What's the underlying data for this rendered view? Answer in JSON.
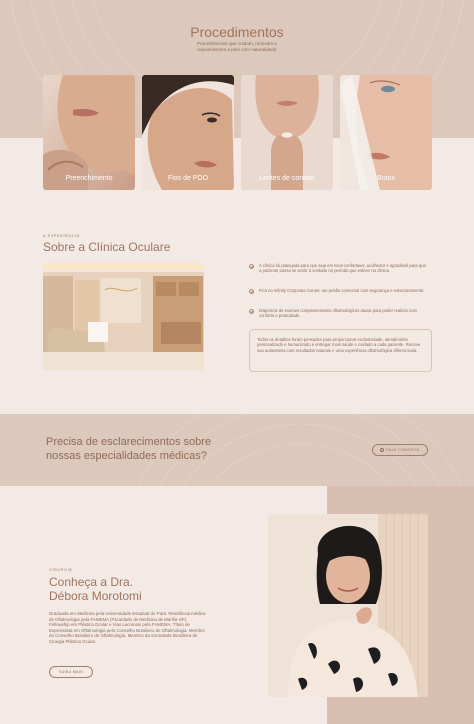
{
  "procedures": {
    "title": "Procedimentos",
    "subtitle": "Procedimentos que cuidam, renovam e rejuvenescem a pele com naturalidade",
    "cards": [
      {
        "label": "Preenchimento"
      },
      {
        "label": "Fios de PDO"
      },
      {
        "label": "Lentes de contato"
      },
      {
        "label": "Botox"
      }
    ]
  },
  "about": {
    "eyebrow": "A EXPERIÊNCIA",
    "title": "Sobre a Clínica Oculare",
    "features": [
      "A clínica foi planejada para que seja em local confortável, acolhedor e agradável para que o paciente possa se sentir à vontade no período que estiver na clínica.",
      "Fica no Infinity Corporate Center, um prédio comercial com segurança e estacionamento.",
      "Dispomos de exames complementares oftalmológicos atuais para poder realizar com conforto e praticidade."
    ],
    "quote": "Todos os detalhes foram pensados para proporcionar exclusividade, atendimento personalizado e humanizado e entregar mais saúde e cuidado a cada paciente. Renove sua autoestima com resultados naturais e uma experiência oftalmológica diferenciada."
  },
  "cta": {
    "text": "Precisa de esclarecimentos sobre nossas especialidades médicas?",
    "button": "FALE CONOSCO"
  },
  "doctor": {
    "eyebrow": "CIRURGIÃ",
    "title_line1": "Conheça a Dra.",
    "title_line2": "Débora Morotomi",
    "bio": "Graduada em Medicina pela Universidade Estadual do Pará. Residência médica de Oftalmologia pela FAMEMA (Faculdade de Medicina de Marília-SP). Fellowship em Plástica Ocular e Vias Lacrimais pela FAMEMA. Título de Especialista em Oftalmologia pelo Conselho Brasileiro de Oftalmologia. Membro do Conselho Brasileiro de Oftalmologia. Membro da Sociedade Brasileira de Cirurgia Plástica Ocular.",
    "button": "SAIBA MAIS"
  },
  "colors": {
    "accent": "#a0735c",
    "sand": "#dcc9bc",
    "background": "#f3eae6",
    "rose": "#d9bfb2"
  },
  "icons": {
    "check": "check-circle-icon",
    "whatsapp": "whatsapp-icon"
  }
}
